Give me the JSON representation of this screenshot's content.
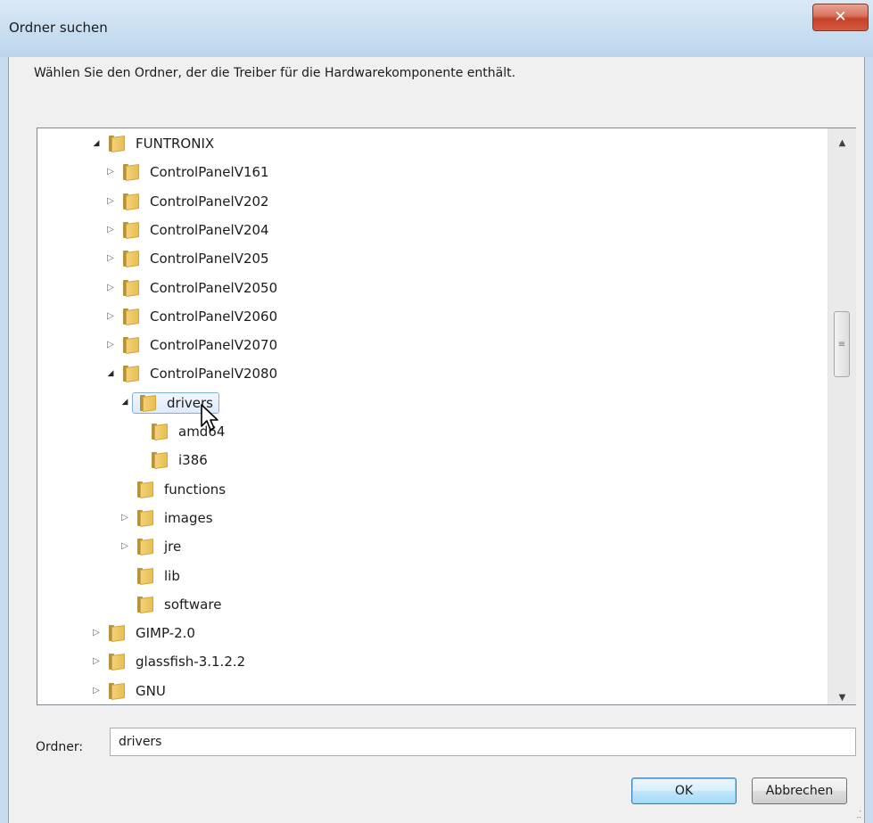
{
  "window": {
    "title": "Ordner suchen",
    "close_glyph": "✕",
    "instruction": "Wählen Sie den Ordner, der die Treiber für die Hardwarekomponente enthält."
  },
  "tree": {
    "items": [
      {
        "label": "FUNTRONIX",
        "expander": "open",
        "level": 0
      },
      {
        "label": "ControlPanelV161",
        "expander": "closed",
        "level": 1
      },
      {
        "label": "ControlPanelV202",
        "expander": "closed",
        "level": 1
      },
      {
        "label": "ControlPanelV204",
        "expander": "closed",
        "level": 1
      },
      {
        "label": "ControlPanelV205",
        "expander": "closed",
        "level": 1
      },
      {
        "label": "ControlPanelV2050",
        "expander": "closed",
        "level": 1
      },
      {
        "label": "ControlPanelV2060",
        "expander": "closed",
        "level": 1
      },
      {
        "label": "ControlPanelV2070",
        "expander": "closed",
        "level": 1
      },
      {
        "label": "ControlPanelV2080",
        "expander": "open",
        "level": 1
      },
      {
        "label": "drivers",
        "expander": "open",
        "level": 2,
        "selected": true
      },
      {
        "label": "amd64",
        "expander": "none",
        "level": 3
      },
      {
        "label": "i386",
        "expander": "none",
        "level": 3
      },
      {
        "label": "functions",
        "expander": "none",
        "level": 2
      },
      {
        "label": "images",
        "expander": "closed",
        "level": 2
      },
      {
        "label": "jre",
        "expander": "closed",
        "level": 2
      },
      {
        "label": "lib",
        "expander": "none",
        "level": 2
      },
      {
        "label": "software",
        "expander": "none",
        "level": 2
      },
      {
        "label": "GIMP-2.0",
        "expander": "closed",
        "level": 0
      },
      {
        "label": "glassfish-3.1.2.2",
        "expander": "closed",
        "level": 0
      },
      {
        "label": "GNU",
        "expander": "closed",
        "level": 0
      }
    ]
  },
  "folder_field": {
    "label": "Ordner:",
    "value": "drivers"
  },
  "buttons": {
    "ok": "OK",
    "cancel": "Abbrechen"
  },
  "icons": {
    "folder": "folder-icon",
    "expander_open": "triangle-down-icon",
    "expander_closed": "triangle-right-icon"
  },
  "colors": {
    "selection_border": "#84acdd",
    "close_button": "#c7412a",
    "ok_button_border": "#3c7fb1"
  }
}
